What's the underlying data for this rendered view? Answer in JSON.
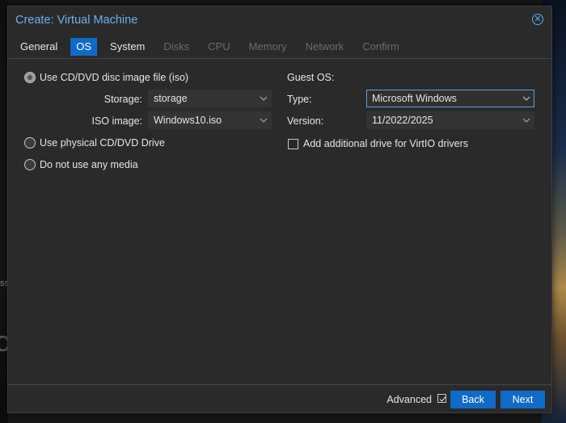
{
  "dialog": {
    "title": "Create: Virtual Machine",
    "tabs": [
      {
        "label": "General",
        "state": "enabled"
      },
      {
        "label": "OS",
        "state": "active"
      },
      {
        "label": "System",
        "state": "enabled"
      },
      {
        "label": "Disks",
        "state": "disabled"
      },
      {
        "label": "CPU",
        "state": "disabled"
      },
      {
        "label": "Memory",
        "state": "disabled"
      },
      {
        "label": "Network",
        "state": "disabled"
      },
      {
        "label": "Confirm",
        "state": "disabled"
      }
    ]
  },
  "media": {
    "options": [
      {
        "label": "Use CD/DVD disc image file (iso)",
        "selected": true
      },
      {
        "label": "Use physical CD/DVD Drive",
        "selected": false
      },
      {
        "label": "Do not use any media",
        "selected": false
      }
    ],
    "storage_label": "Storage:",
    "storage_value": "storage",
    "iso_label": "ISO image:",
    "iso_value": "Windows10.iso"
  },
  "guest_os": {
    "heading": "Guest OS:",
    "type_label": "Type:",
    "type_value": "Microsoft Windows",
    "version_label": "Version:",
    "version_value": "11/2022/2025",
    "virtio_label": "Add additional drive for VirtIO drivers",
    "virtio_checked": false
  },
  "footer": {
    "advanced_label": "Advanced",
    "advanced_checked": true,
    "back_label": "Back",
    "next_label": "Next"
  },
  "background": {
    "left_text": "ss"
  },
  "colors": {
    "accent": "#0f6bc7",
    "title": "#6cb0ee",
    "dialog_bg": "#2a2a2a",
    "disabled_text": "#6b6b6b"
  }
}
